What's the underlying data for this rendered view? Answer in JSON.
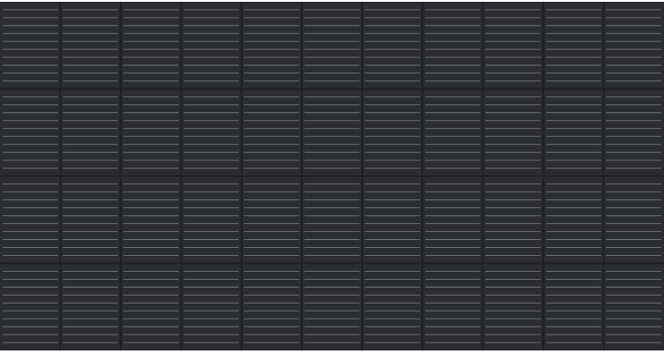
{
  "image": {
    "subject": "solar-panel-cells",
    "colors": {
      "panel": "#2b2d31",
      "finger_line": "#8d9096",
      "cell_gap": "#1f2024",
      "border": "#ffffff"
    },
    "grid": {
      "columns": 11,
      "rows": 4,
      "fingers_per_row": 10
    }
  }
}
